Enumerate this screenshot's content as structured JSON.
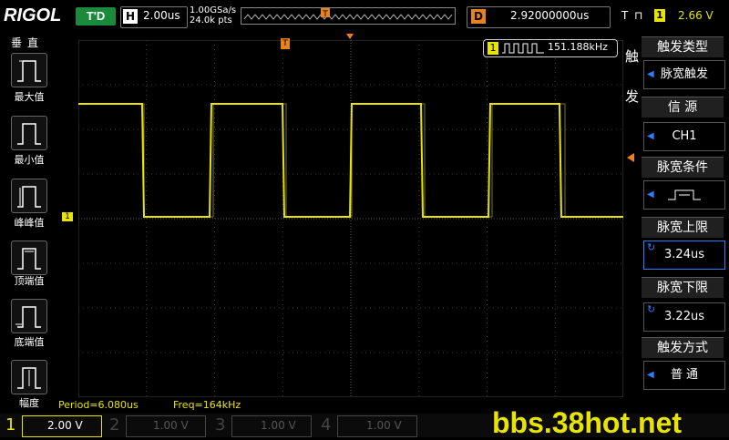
{
  "top": {
    "logo": "RIGOL",
    "run_state": "T'D",
    "h_label": "H",
    "timebase": "2.00us",
    "sample_rate": "1.00GSa/s",
    "points": "24.0k pts",
    "mem_marker": "T",
    "d_label": "D",
    "delay": "2.92000000us",
    "trig_label": "T",
    "trig_symbol": "⊓",
    "trig_channel": "1",
    "trig_level": "2.66 V"
  },
  "left": {
    "title": "垂直",
    "items": [
      {
        "label": "最大值"
      },
      {
        "label": "最小值"
      },
      {
        "label": "峰峰值"
      },
      {
        "label": "顶端值"
      },
      {
        "label": "底端值"
      },
      {
        "label": "幅度"
      }
    ]
  },
  "screen": {
    "freq_badge_ch": "1",
    "freq_badge": "151.188kHz",
    "ch1_marker": "1",
    "trig_marker": "T"
  },
  "menu": {
    "side_chars": [
      "触",
      "发"
    ],
    "items": [
      {
        "title": "触发类型",
        "value": "脉宽触发"
      },
      {
        "title": "信 源",
        "value": "CH1"
      },
      {
        "title": "脉宽条件",
        "value": ""
      },
      {
        "title": "脉宽上限",
        "value": "3.24us"
      },
      {
        "title": "脉宽下限",
        "value": "3.22us"
      },
      {
        "title": "触发方式",
        "value": "普 通"
      }
    ]
  },
  "measure": {
    "period": "Period=6.080us",
    "freq": "Freq=164kHz"
  },
  "channels": [
    {
      "num": "1",
      "scale": "2.00 V",
      "color": "#e8e400"
    },
    {
      "num": "2",
      "scale": "1.00 V",
      "color": "#00c8c8"
    },
    {
      "num": "3",
      "scale": "1.00 V",
      "color": "#d000d0"
    },
    {
      "num": "4",
      "scale": "1.00 V",
      "color": "#2a7fff"
    }
  ],
  "watermark": "bbs.38hot.net",
  "colors": {
    "ch1": "#e8e400",
    "trigger": "#e8821e",
    "run": "#1b8a3a"
  }
}
